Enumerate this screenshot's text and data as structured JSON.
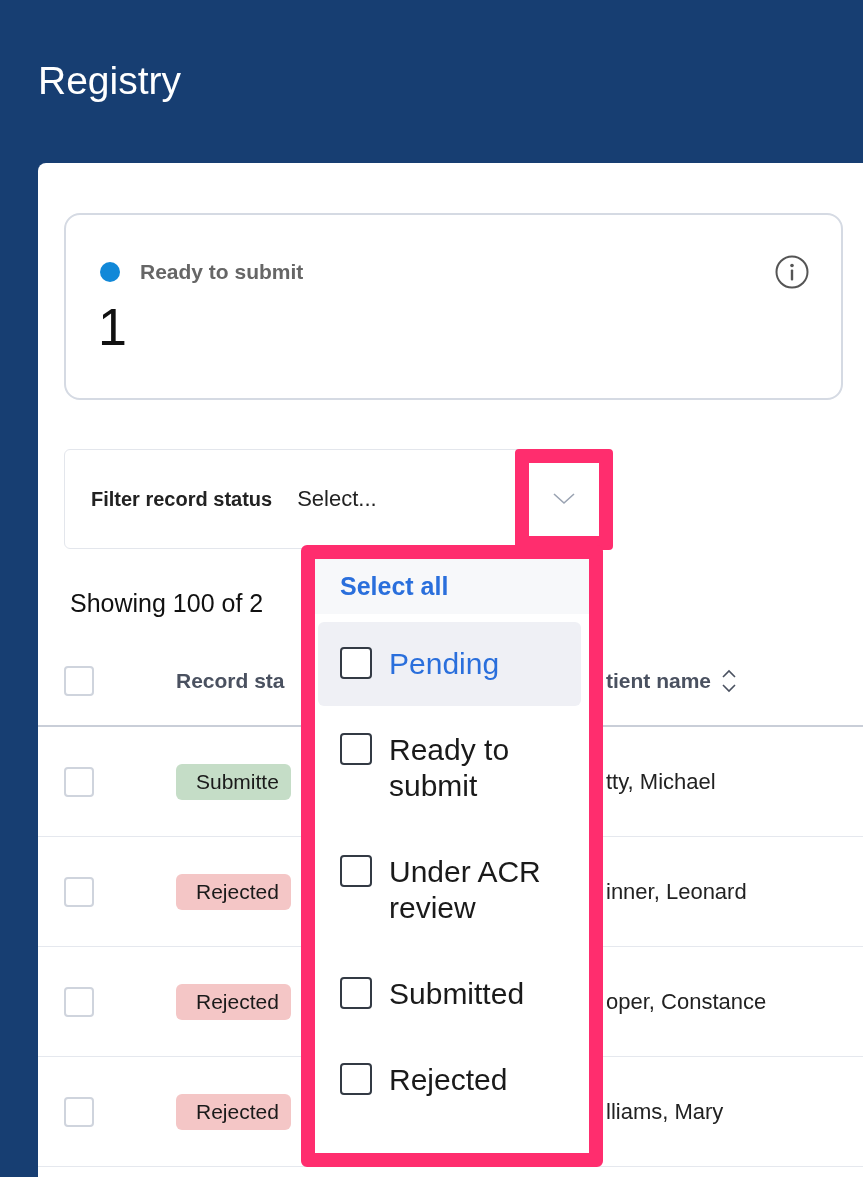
{
  "header": {
    "title": "Registry"
  },
  "summary": {
    "status": "Ready to submit",
    "count": "1",
    "color": "#1188d8"
  },
  "filter": {
    "label": "Filter record status",
    "placeholder": "Select...",
    "expanded": true
  },
  "dropdown": {
    "select_all": "Select all",
    "options": [
      {
        "label": "Pending",
        "checked": false,
        "highlighted": true
      },
      {
        "label": "Ready to submit",
        "checked": false,
        "highlighted": false
      },
      {
        "label": "Under ACR review",
        "checked": false,
        "highlighted": false
      },
      {
        "label": "Submitted",
        "checked": false,
        "highlighted": false
      },
      {
        "label": "Rejected",
        "checked": false,
        "highlighted": false
      }
    ]
  },
  "table": {
    "summary": "Showing 100 of 2",
    "select_all_checked": false,
    "columns": [
      {
        "label": "Record sta"
      },
      {
        "label": "tient name",
        "sortable": true
      }
    ],
    "rows": [
      {
        "checked": false,
        "status": "Submitte",
        "kind": "submitted",
        "patient": "tty, Michael"
      },
      {
        "checked": false,
        "status": "Rejected",
        "kind": "rejected",
        "patient": "inner, Leonard"
      },
      {
        "checked": false,
        "status": "Rejected",
        "kind": "rejected",
        "patient": "oper, Constance"
      },
      {
        "checked": false,
        "status": "Rejected",
        "kind": "rejected",
        "patient": "lliams, Mary"
      }
    ]
  }
}
